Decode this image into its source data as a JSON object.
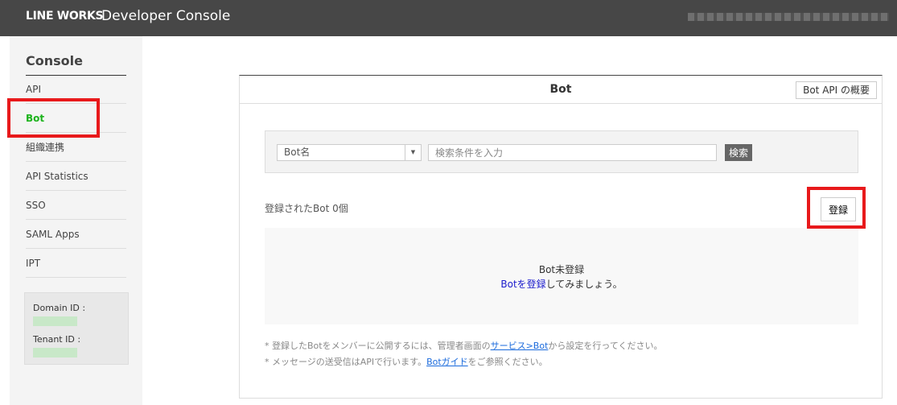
{
  "header": {
    "logo": "LINE WORKS",
    "title": "Developer Console"
  },
  "sidebar": {
    "title": "Console",
    "items": [
      {
        "label": "API"
      },
      {
        "label": "Bot"
      },
      {
        "label": "組織連携"
      },
      {
        "label": "API Statistics"
      },
      {
        "label": "SSO"
      },
      {
        "label": "SAML Apps"
      },
      {
        "label": "IPT"
      }
    ],
    "domain_label": "Domain ID :",
    "tenant_label": "Tenant ID :"
  },
  "main": {
    "title": "Bot",
    "api_overview": "Bot API の概要",
    "search": {
      "select_value": "Bot名",
      "placeholder": "検索条件を入力",
      "button": "検索"
    },
    "count_text": "登録されたBot 0個",
    "register_button": "登録",
    "empty": {
      "line1": "Bot未登録",
      "link": "Botを登録",
      "rest": "してみましょう。"
    },
    "notes": [
      {
        "pre": "* 登録したBotをメンバーに公開するには、管理者画面の",
        "link": "サービス>Bot",
        "post": "から設定を行ってください。"
      },
      {
        "pre": "* メッセージの送受信はAPIで行います。",
        "link": "Botガイド",
        "post": "をご参照ください。"
      }
    ]
  },
  "colors": {
    "active": "#1cb31c",
    "highlight": "#e8191b",
    "header": "#474747"
  }
}
